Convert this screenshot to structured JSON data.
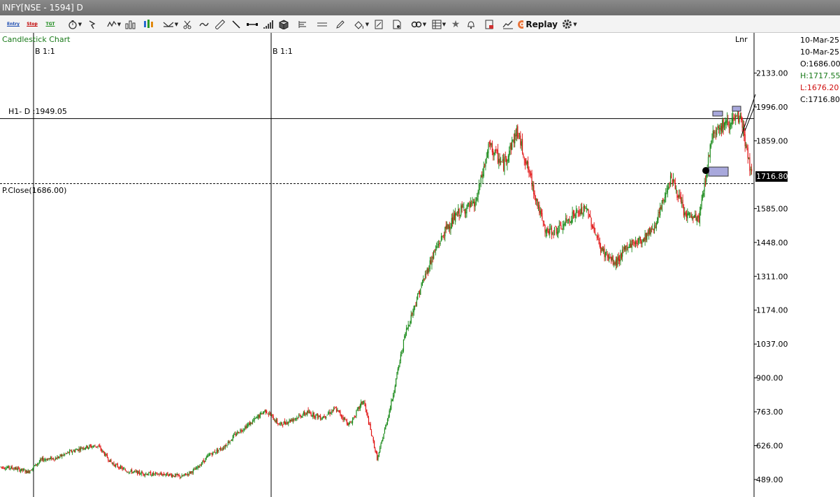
{
  "window": {
    "title": "INFY[NSE - 1594] D"
  },
  "toolbar": {
    "entry_label": "Entry",
    "stop_label": "Stop",
    "target_label": "TGT",
    "replay_label": "Replay",
    "icons": [
      "entry-icon",
      "stop-icon",
      "target-icon",
      "stopwatch-icon",
      "pin-icon",
      "indicator-icon",
      "bar-chart-icon",
      "candlestick-icon",
      "crosshair-icon",
      "scissors-icon",
      "wave-icon",
      "ruler-icon",
      "trendline-icon",
      "horizontal-line-icon",
      "volume-icon",
      "cube-icon",
      "fork-icon",
      "parallel-lines-icon",
      "pencil-icon",
      "paint-icon",
      "eraser-icon",
      "script-icon",
      "link-icon",
      "layers-icon",
      "star-icon",
      "alert-bell-icon",
      "notes-icon",
      "linechart-icon",
      "replay-icon",
      "settings-gear-icon"
    ]
  },
  "chart": {
    "type_label": "Candlestick Chart",
    "scale_label": "Lnr",
    "marker1": "B 1:1",
    "marker2": "B 1:1",
    "high_line_label": "H1- D :1949.05",
    "prev_close_label": "P.Close(1686.00)",
    "current_price": "1716.80",
    "ohlc": {
      "date1": "10-Mar-25",
      "date2": "10-Mar-25",
      "open": "O:1686.00",
      "high": "H:1717.55",
      "low": "L:1676.20",
      "close": "C:1716.80"
    },
    "colors": {
      "up": "#1a8a1a",
      "down": "#e01010",
      "grid": "#000000"
    }
  },
  "chart_data": {
    "type": "line",
    "title": "",
    "xlabel": "",
    "ylabel": "",
    "y_scale": "linear",
    "ylim": [
      420,
      2225
    ],
    "y_ticks": [
      489,
      626,
      763,
      900,
      1037,
      1174,
      1311,
      1448,
      1585,
      1716.8,
      1859,
      1996,
      2133
    ],
    "y_tick_labels": [
      "489.00",
      "626.00",
      "763.00",
      "900.00",
      "1037.00",
      "1174.00",
      "1311.00",
      "1448.00",
      "1585.00",
      "1716.80",
      "1859.00",
      "1996.00",
      "2133.00"
    ],
    "reference_lines": [
      {
        "name": "H1- D :1949.05",
        "value": 1949.05,
        "style": "solid"
      },
      {
        "name": "P.Close(1686.00)",
        "value": 1686.0,
        "style": "dashed"
      }
    ],
    "last_close": 1716.8,
    "series": [
      {
        "x": [
          0,
          20,
          40,
          60,
          80,
          100,
          120,
          140,
          160,
          180,
          200,
          220,
          240,
          260,
          280,
          300,
          320,
          340,
          360,
          380,
          400,
          420,
          440,
          460,
          480,
          500,
          520,
          540,
          560,
          580,
          600,
          620,
          640,
          660,
          680,
          700,
          720,
          740,
          760,
          780,
          800,
          820,
          840,
          860,
          880,
          900,
          920,
          940,
          960,
          980,
          1000,
          1020,
          1040,
          1060,
          1076
        ],
        "y": [
          540,
          535,
          520,
          570,
          575,
          600,
          620,
          625,
          555,
          525,
          515,
          510,
          510,
          500,
          530,
          590,
          620,
          680,
          720,
          770,
          710,
          735,
          760,
          740,
          775,
          710,
          810,
          570,
          800,
          1080,
          1250,
          1400,
          1510,
          1580,
          1600,
          1840,
          1760,
          1900,
          1700,
          1490,
          1500,
          1560,
          1580,
          1420,
          1360,
          1440,
          1460,
          1530,
          1720,
          1560,
          1540,
          1900,
          1930,
          1950,
          1710
        ]
      }
    ]
  }
}
